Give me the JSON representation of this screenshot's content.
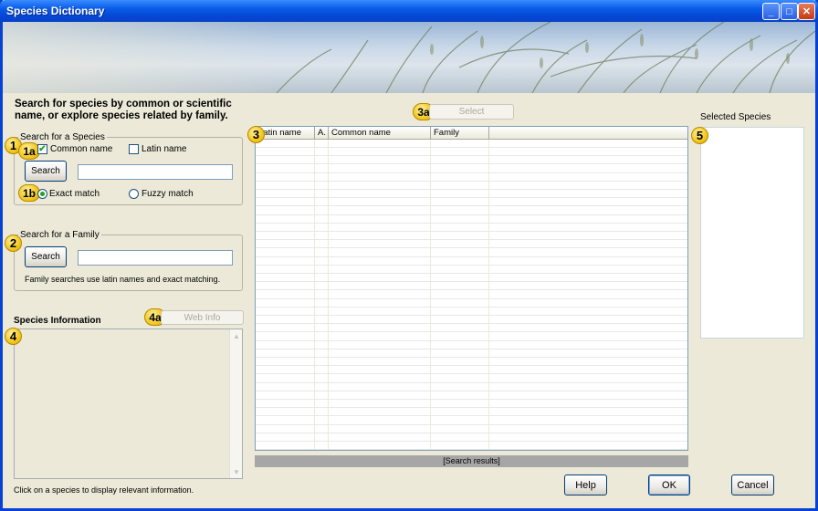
{
  "window": {
    "title": "Species Dictionary",
    "controls": {
      "minimize": "_",
      "maximize": "□",
      "close": "✕"
    }
  },
  "intro": "Search for species by common or scientific name, or explore species related by family.",
  "species_search": {
    "legend": "Search for a Species",
    "common_name_label": "Common name",
    "common_name_checked": true,
    "latin_name_label": "Latin name",
    "latin_name_checked": false,
    "search_button": "Search",
    "query": "",
    "exact_label": "Exact match",
    "fuzzy_label": "Fuzzy match",
    "match_mode": "exact"
  },
  "family_search": {
    "legend": "Search for a Family",
    "search_button": "Search",
    "query": "",
    "note": "Family searches use latin names and exact matching."
  },
  "species_info": {
    "heading": "Species Information",
    "web_info_button": "Web Info",
    "hint": "Click on a species to display relevant information."
  },
  "results": {
    "select_button": "Select",
    "columns": [
      "Latin name",
      "A.",
      "Common name",
      "Family"
    ],
    "rows": [],
    "status": "[Search results]"
  },
  "selected_species": {
    "label": "Selected Species",
    "items": []
  },
  "buttons": {
    "help": "Help",
    "ok": "OK",
    "cancel": "Cancel"
  },
  "badges": {
    "b1": "1",
    "b1a": "1a",
    "b1b": "1b",
    "b2": "2",
    "b3": "3",
    "b3a": "3a",
    "b4": "4",
    "b4a": "4a",
    "b5": "5"
  },
  "colors": {
    "title_bar": "#0A5BE8",
    "badge": "#F3C61C",
    "window_bg": "#ECE9D8"
  }
}
